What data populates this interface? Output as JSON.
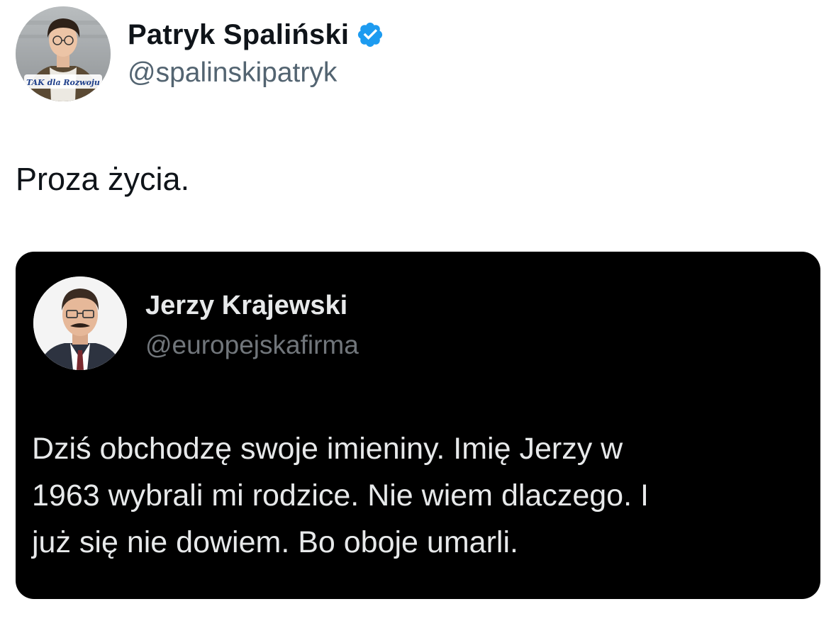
{
  "tweet": {
    "author": {
      "name": "Patryk Spaliński",
      "handle": "@spalinskipatryk",
      "verified": true,
      "avatar_caption": "TAK dla Rozwoju"
    },
    "text": "Proza życia.",
    "quoted_image": {
      "author": {
        "name": "Jerzy Krajewski",
        "handle": "@europejskafirma"
      },
      "text_lines": [
        "Dziś obchodzę swoje imieniny. Imię Jerzy w",
        "1963 wybrali mi rodzice. Nie wiem dlaczego. I",
        "już się nie dowiem. Bo oboje umarli."
      ]
    }
  },
  "colors": {
    "text_primary": "#0f1419",
    "text_secondary": "#536471",
    "verified_blue": "#1d9bf0",
    "card_background": "#000000",
    "card_text": "#e7e9ea",
    "card_secondary": "#71767b"
  },
  "icons": {
    "verified": "verified-badge-icon"
  }
}
